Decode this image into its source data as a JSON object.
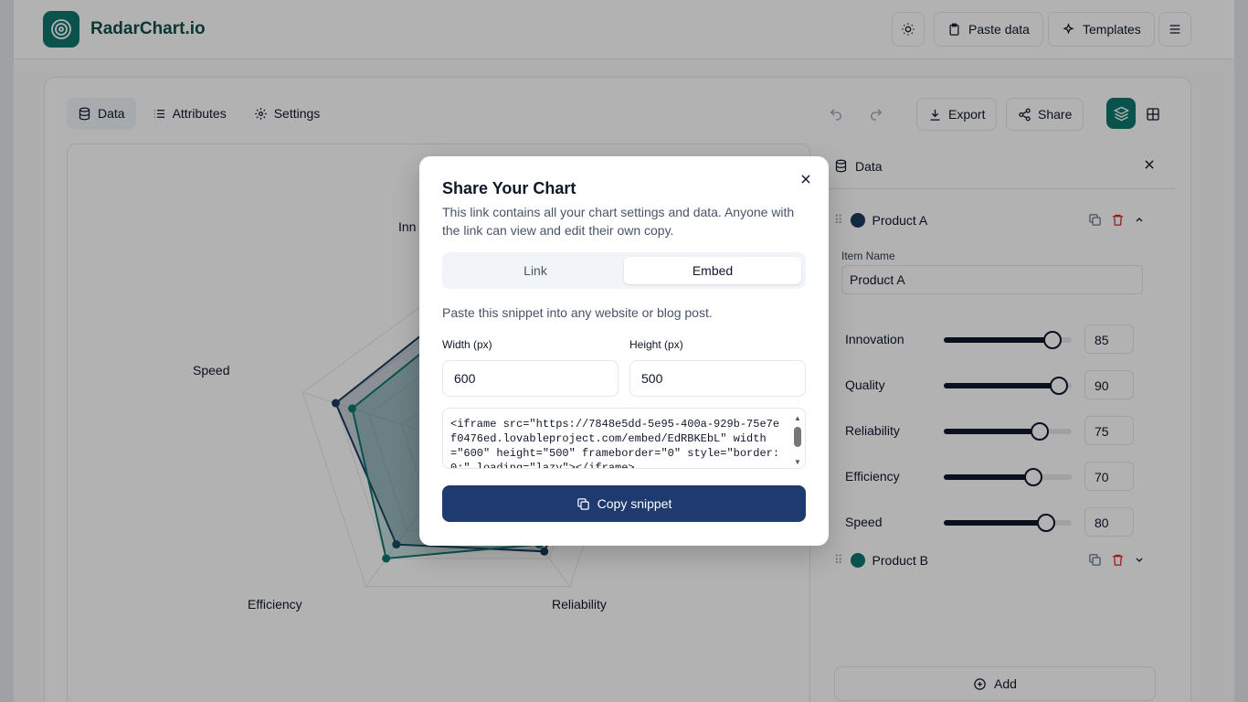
{
  "app": {
    "brand": "RadarChart.io"
  },
  "topbar": {
    "paste_label": "Paste data",
    "templates_label": "Templates"
  },
  "tabs": [
    {
      "label": "Data"
    },
    {
      "label": "Attributes"
    },
    {
      "label": "Settings"
    }
  ],
  "toolbar": {
    "export_label": "Export",
    "share_label": "Share"
  },
  "chart_data": {
    "type": "radar",
    "axes": [
      "Innovation",
      "Quality",
      "Reliability",
      "Efficiency",
      "Speed"
    ],
    "visible_axis_labels": {
      "innovation_partial": "Inn",
      "speed": "Speed",
      "efficiency": "Efficiency",
      "reliability": "Reliability"
    },
    "series": [
      {
        "name": "Product A",
        "values": [
          85,
          90,
          75,
          70,
          80
        ],
        "color": "#1e3a5f"
      },
      {
        "name": "Product B",
        "values": [
          75,
          80,
          70,
          80,
          70
        ],
        "color": "#0f766e"
      }
    ],
    "range": [
      0,
      100
    ]
  },
  "data_panel": {
    "title": "Data",
    "items": [
      {
        "name": "Product A",
        "color": "#1e3a5f",
        "expanded": true,
        "field_label": "Item Name",
        "field_value": "Product A",
        "attributes": [
          {
            "name": "Innovation",
            "value": 85
          },
          {
            "name": "Quality",
            "value": 90
          },
          {
            "name": "Reliability",
            "value": 75
          },
          {
            "name": "Efficiency",
            "value": 70
          },
          {
            "name": "Speed",
            "value": 80
          }
        ]
      },
      {
        "name": "Product B",
        "color": "#0f766e",
        "expanded": false
      }
    ],
    "add_label": "Add"
  },
  "modal": {
    "title": "Share Your Chart",
    "description": "This link contains all your chart settings and data. Anyone with the link can view and edit their own copy.",
    "tabs": [
      {
        "label": "Link"
      },
      {
        "label": "Embed"
      }
    ],
    "active_tab": "Embed",
    "hint": "Paste this snippet into any website or blog post.",
    "width_label": "Width (px)",
    "width_value": "600",
    "height_label": "Height (px)",
    "height_value": "500",
    "snippet": "<iframe src=\"https://7848e5dd-5e95-400a-929b-75e7ef0476ed.lovableproject.com/embed/EdRBKEbL\" width=\"600\" height=\"500\" frameborder=\"0\" style=\"border:0;\" loading=\"lazy\"></iframe>",
    "copy_label": "Copy snippet"
  }
}
